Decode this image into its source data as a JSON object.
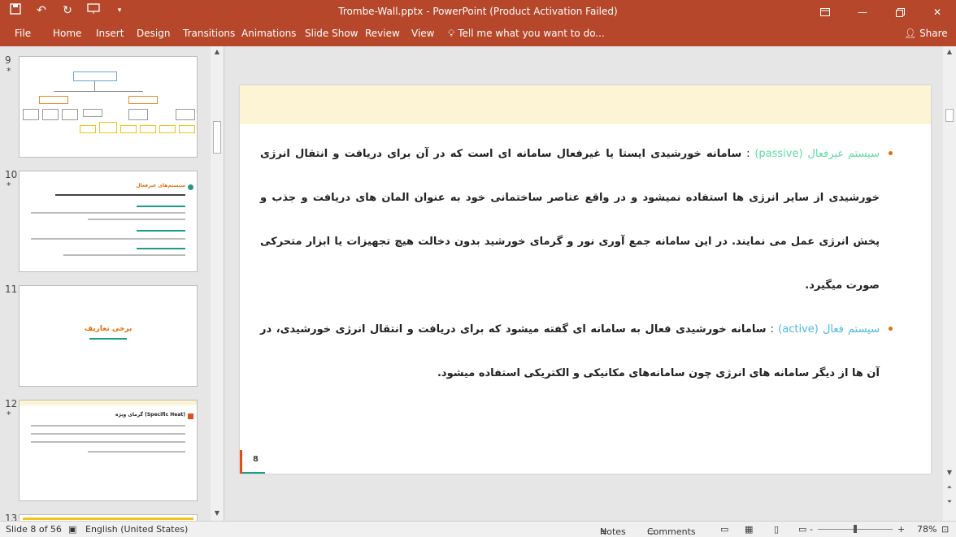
{
  "window": {
    "title": "Trombe-Wall.pptx - PowerPoint (Product Activation Failed)"
  },
  "qat": {
    "save_icon": "save-icon",
    "undo_icon": "undo-icon",
    "redo_icon": "redo-icon",
    "present_icon": "present-from-beginning-icon",
    "customize_icon": "customize-qat-icon"
  },
  "ribbon": {
    "tabs": [
      "File",
      "Home",
      "Insert",
      "Design",
      "Transitions",
      "Animations",
      "Slide Show",
      "Review",
      "View"
    ],
    "tell_me": "Tell me what you want to do...",
    "share": "Share"
  },
  "thumbnails": [
    {
      "number": "9",
      "star": "*"
    },
    {
      "number": "10",
      "star": "*",
      "title": "سیستم‌های غیرفعال"
    },
    {
      "number": "11",
      "title": "برخی تعاریف"
    },
    {
      "number": "12",
      "star": "*",
      "title": "گرمای ویژه (Specific Heat)"
    },
    {
      "number": "13"
    }
  ],
  "slide": {
    "paragraph1": {
      "term": "سیستم غیرفعال (passive)",
      "separator": " : ",
      "text": "سامانه خورشیدی ایستا یا غیرفعال سامانه ای است که در آن برای دریافت و انتقال انرژی خورشیدی از سایر انرژی ها استفاده نمیشود و در واقع عناصر ساختمانی خود به عنوان المان های دریافت و جذب و پخش انرژی عمل می نمایند. در این سامانه جمع آوری نور و گرمای خورشید بدون دخالت هیچ تجهیزات یا ابزار متحرکی صورت میگیرد."
    },
    "paragraph2": {
      "term": "سیستم فعال (active)",
      "separator": " : ",
      "text": "سامانه خورشیدی فعال به سامانه ای گفته میشود که برای دریافت و انتقال انرژی خورشیدی، در آن ها از دیگر سامانه های انرژی چون سامانه‌های مکانیکی و الکتریکی استفاده میشود."
    },
    "page_number": "8"
  },
  "status": {
    "slide_info": "Slide 8 of 56",
    "language": "English (United States)",
    "notes": "Notes",
    "comments": "Comments",
    "zoom_minus": "-",
    "zoom_plus": "+",
    "zoom": "78%"
  },
  "colors": {
    "ribbon": "#b7472a",
    "passive_term": "#5fdaa6",
    "active_term": "#4fb8e6",
    "bullet": "#e46c0a",
    "header_band": "#fdf3d5"
  }
}
